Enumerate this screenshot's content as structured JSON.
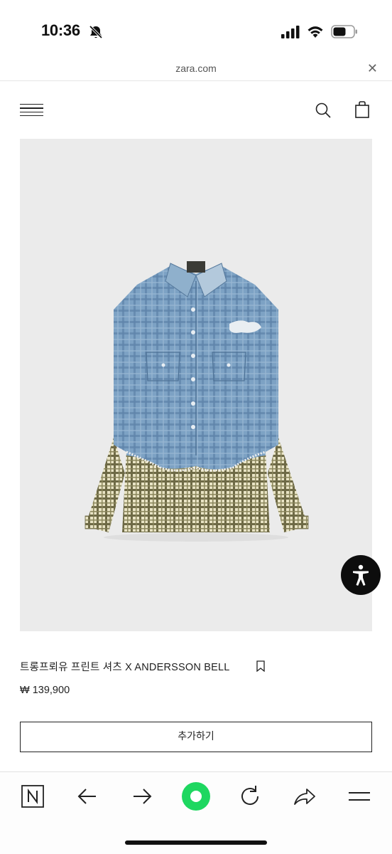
{
  "status_bar": {
    "time": "10:36",
    "icons": [
      "bell-slash-icon",
      "cellular-signal-icon",
      "wifi-icon",
      "battery-icon"
    ]
  },
  "browser": {
    "url": "zara.com",
    "close_icon": "close-icon",
    "toolbar_icons": [
      "naver-home-icon",
      "back-arrow-icon",
      "forward-arrow-icon",
      "green-dot-icon",
      "reload-icon",
      "share-icon",
      "menu-icon"
    ],
    "accent_green": "#1ed760"
  },
  "site_header": {
    "menu_icon": "hamburger-icon",
    "search_icon": "search-icon",
    "bag_icon": "shopping-bag-icon"
  },
  "product": {
    "image_desc_icon": "denim-plaid-shirt-image",
    "title": "트롱프뢰유 프린트 셔츠 X ANDERSSON BELL",
    "price": "₩ 139,900",
    "add_button_label": "추가하기",
    "bookmark_icon": "bookmark-icon"
  },
  "floating": {
    "accessibility_icon": "accessibility-icon"
  }
}
